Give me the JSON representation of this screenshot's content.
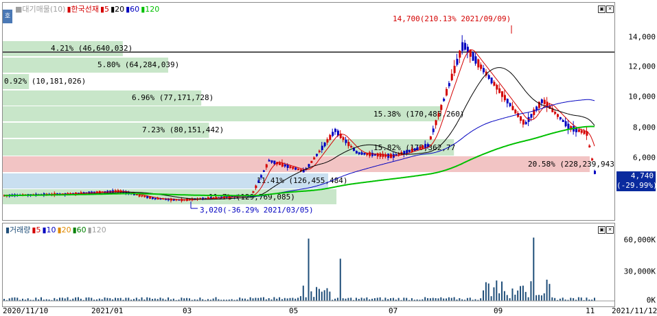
{
  "legend": {
    "items": [
      {
        "label": "■대기매물(10)",
        "color": "#a0a0a0"
      },
      {
        "label": "▮한국선재",
        "color": "#d40000"
      },
      {
        "label": "▮5",
        "color": "#d40000"
      },
      {
        "label": "▮20",
        "color": "#000000"
      },
      {
        "label": "▮60",
        "color": "#0000c0"
      },
      {
        "label": "▮120",
        "color": "#00c000"
      }
    ]
  },
  "side_icon_label": "호",
  "volume_legend": {
    "items": [
      {
        "label": "▮거래량",
        "color": "#1f4e79"
      },
      {
        "label": "▮5",
        "color": "#d40000"
      },
      {
        "label": "▮10",
        "color": "#0000c0"
      },
      {
        "label": "▮20",
        "color": "#e08a00"
      },
      {
        "label": "▮60",
        "color": "#008000"
      },
      {
        "label": "▮120",
        "color": "#a0a0a0"
      }
    ]
  },
  "price_axis": [
    "14,000",
    "12,000",
    "10,000",
    "8,000",
    "6,000"
  ],
  "volume_axis": [
    "60,000K",
    "30,000K",
    "0K"
  ],
  "date_axis": [
    "2020/11/10",
    "2021/01",
    "03",
    "05",
    "07",
    "09",
    "11",
    "2021/11/12"
  ],
  "current_price": {
    "value": "4,740",
    "change": "(-29.99%)"
  },
  "annotations": {
    "high": "14,700(210.13% 2021/09/09)",
    "low": "3,020(-36.29% 2021/03/05)"
  },
  "volume_profile": [
    {
      "label": "4.21% (46,640,032)",
      "color": "green",
      "width_pct": 4.21
    },
    {
      "label": "5.80% (64,284,039)",
      "color": "green",
      "width_pct": 5.8
    },
    {
      "label": "0.92% (10,181,026)",
      "color": "green",
      "width_pct": 0.92
    },
    {
      "label": "6.96% (77,171,728)",
      "color": "green",
      "width_pct": 6.96
    },
    {
      "label": "15.38% (170,485,260)",
      "color": "green",
      "width_pct": 15.38
    },
    {
      "label": "7.23% (80,151,442)",
      "color": "green",
      "width_pct": 7.23
    },
    {
      "label": "15.82% (175,362,77",
      "color": "green",
      "width_pct": 15.82
    },
    {
      "label": "20.58% (228,239,943)",
      "color": "red",
      "width_pct": 20.58
    },
    {
      "label": "11.41% (126,455,484)",
      "color": "blue",
      "width_pct": 11.41
    },
    {
      "label": "11.7% (129,769,085)",
      "color": "green",
      "width_pct": 11.7
    }
  ],
  "colors": {
    "up": "#d40000",
    "down": "#0000c0",
    "ma5": "#d40000",
    "ma20": "#000000",
    "ma60": "#0000c0",
    "ma120": "#00c000",
    "profile_green": "#c8e6c9",
    "profile_red": "#f2c4c4",
    "profile_blue": "#c9dff0",
    "volume_bar": "#1f4e79"
  }
}
